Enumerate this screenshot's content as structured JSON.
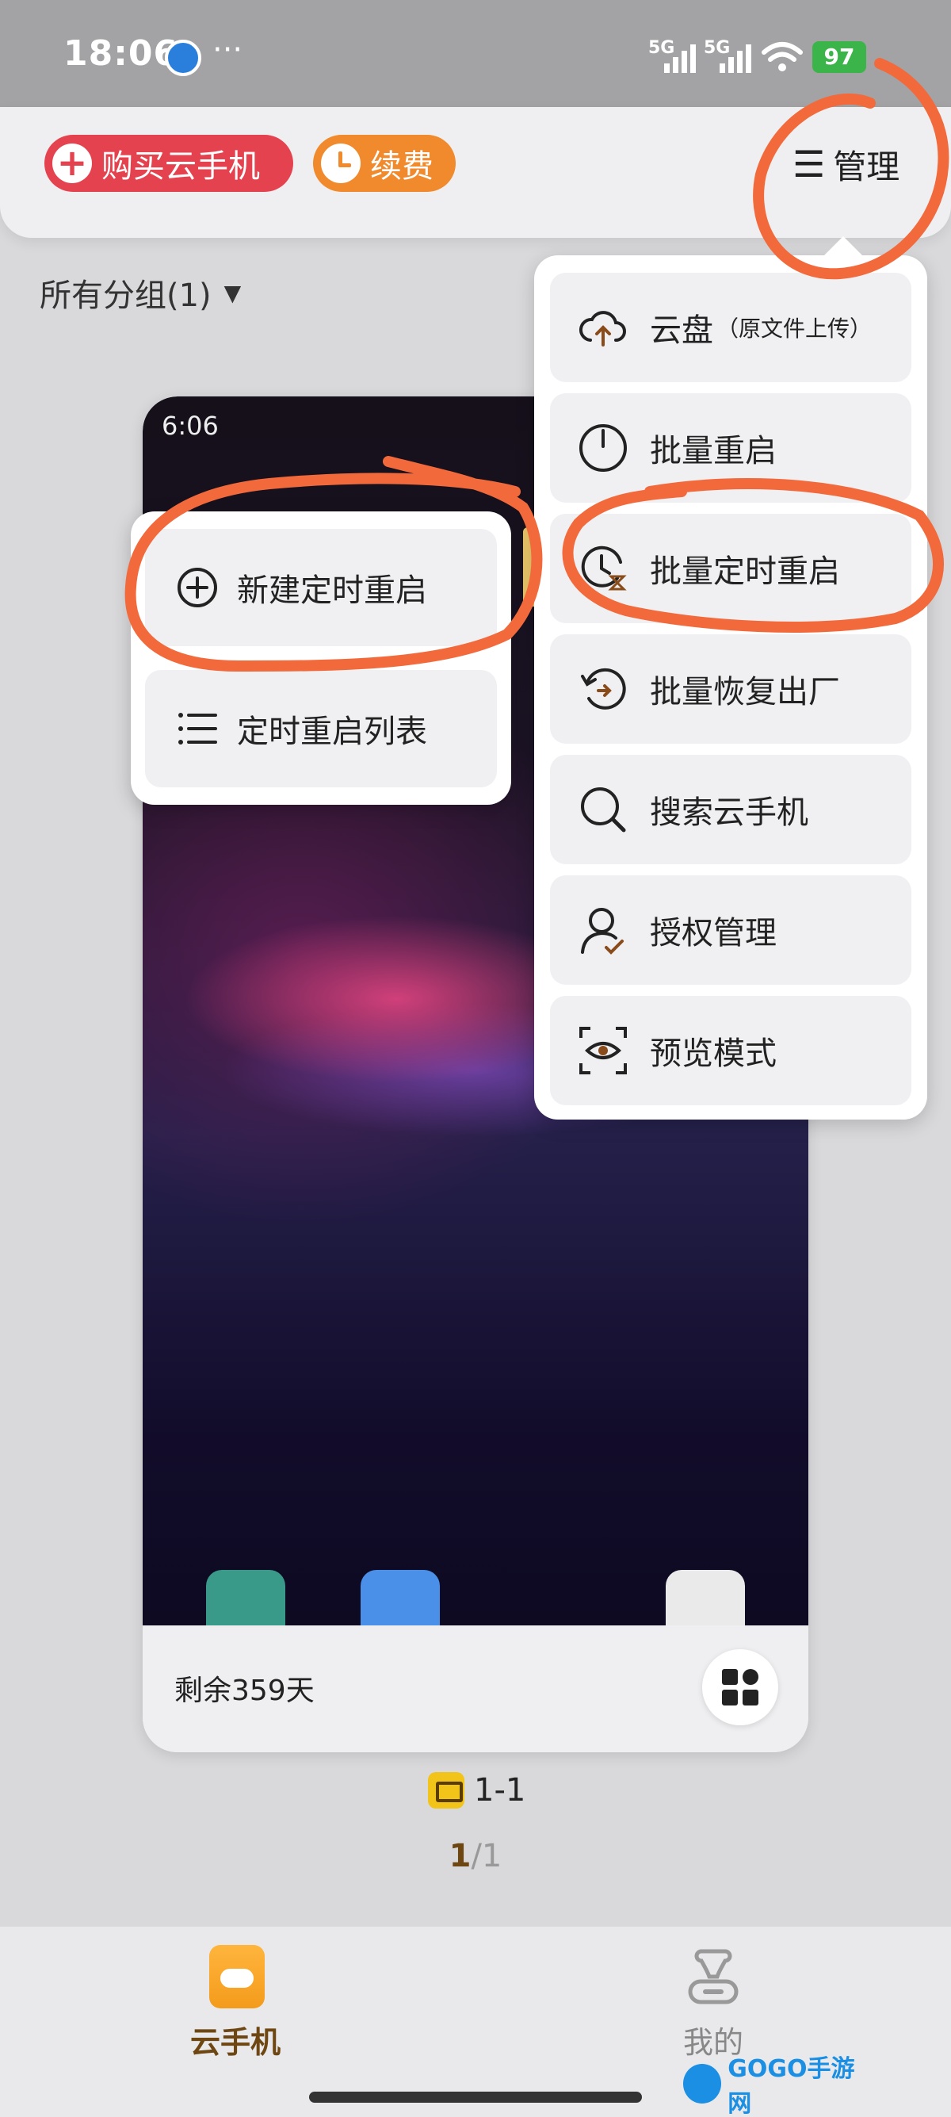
{
  "status_bar": {
    "time": "18:06",
    "more": "···",
    "signal_1": "5G",
    "signal_2": "5G",
    "battery": "97"
  },
  "topbar": {
    "buy_label": "购买云手机",
    "buy_icon": "plus-circle-icon",
    "renew_label": "续费",
    "renew_icon": "clock-icon",
    "manage_label": "管理",
    "manage_icon": "list-icon"
  },
  "group_selector": {
    "label": "所有分组(1)",
    "icon": "chevron-down-icon"
  },
  "phone_card": {
    "screen_time": "6:06",
    "remaining": "剩余359天",
    "grid_icon": "app-grid-icon"
  },
  "device_tag": {
    "label": "1-1"
  },
  "pager": {
    "current": "1",
    "total": "/1"
  },
  "manage_menu": {
    "items": [
      {
        "label": "云盘",
        "sub": "（原文件上传）",
        "icon": "cloud-upload-icon"
      },
      {
        "label": "批量重启",
        "icon": "power-icon"
      },
      {
        "label": "批量定时重启",
        "icon": "timer-hourglass-icon"
      },
      {
        "label": "批量恢复出厂",
        "icon": "restore-icon"
      },
      {
        "label": "搜索云手机",
        "icon": "search-icon"
      },
      {
        "label": "授权管理",
        "icon": "user-check-icon"
      },
      {
        "label": "预览模式",
        "icon": "eye-scan-icon"
      }
    ]
  },
  "timer_submenu": {
    "items": [
      {
        "label": "新建定时重启",
        "icon": "plus-circle-icon"
      },
      {
        "label": "定时重启列表",
        "icon": "list-icon"
      }
    ]
  },
  "bottom_nav": {
    "tabs": [
      {
        "label": "云手机",
        "icon": "cloud-phone-icon",
        "active": true
      },
      {
        "label": "我的",
        "icon": "profile-icon",
        "active": false
      }
    ]
  },
  "watermark": {
    "text": "GOGO手游网"
  },
  "colors": {
    "accent_brown": "#6e4612",
    "buy_red": "#e5424f",
    "renew_orange": "#f08a2c",
    "scribble_orange": "#f26a3c"
  }
}
